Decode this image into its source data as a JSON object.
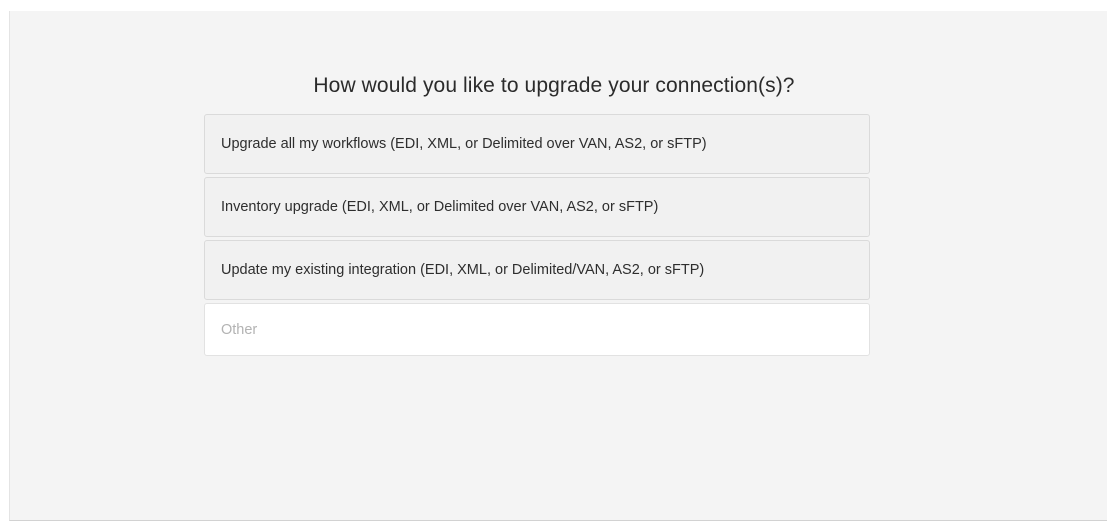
{
  "question": "How would you like to upgrade your connection(s)?",
  "options": [
    {
      "label": "Upgrade all my workflows (EDI, XML, or Delimited over VAN, AS2, or sFTP)"
    },
    {
      "label": "Inventory upgrade (EDI, XML, or Delimited over VAN, AS2, or sFTP)"
    },
    {
      "label": "Update my existing integration (EDI, XML, or Delimited/VAN, AS2, or sFTP)"
    }
  ],
  "other": {
    "placeholder": "Other",
    "value": ""
  }
}
